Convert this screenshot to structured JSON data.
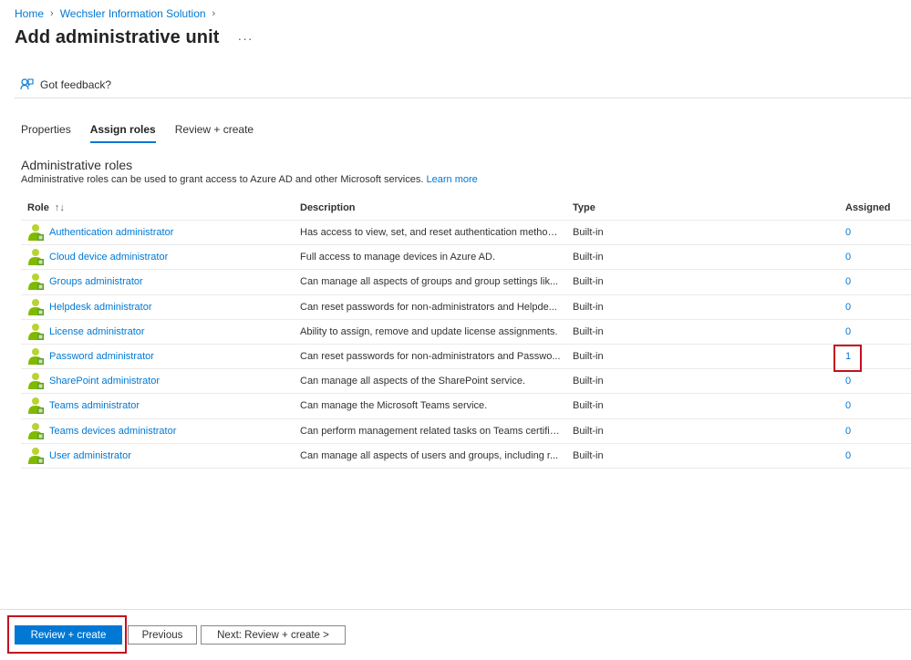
{
  "breadcrumb": {
    "home": "Home",
    "tenant": "Wechsler Information Solution"
  },
  "header": {
    "title": "Add administrative unit",
    "more": "···"
  },
  "feedback": {
    "label": "Got feedback?"
  },
  "tabs": [
    {
      "label": "Properties",
      "active": false
    },
    {
      "label": "Assign roles",
      "active": true
    },
    {
      "label": "Review + create",
      "active": false
    }
  ],
  "section": {
    "title": "Administrative roles",
    "description": "Administrative roles can be used to grant access to Azure AD and other Microsoft services.",
    "learn_more": "Learn more"
  },
  "table": {
    "headers": {
      "role": "Role",
      "description": "Description",
      "type": "Type",
      "assigned": "Assigned"
    },
    "rows": [
      {
        "role": "Authentication administrator",
        "description": "Has access to view, set, and reset authentication method ...",
        "type": "Built-in",
        "assigned": "0"
      },
      {
        "role": "Cloud device administrator",
        "description": "Full access to manage devices in Azure AD.",
        "type": "Built-in",
        "assigned": "0"
      },
      {
        "role": "Groups administrator",
        "description": "Can manage all aspects of groups and group settings lik...",
        "type": "Built-in",
        "assigned": "0"
      },
      {
        "role": "Helpdesk administrator",
        "description": "Can reset passwords for non-administrators and Helpde...",
        "type": "Built-in",
        "assigned": "0"
      },
      {
        "role": "License administrator",
        "description": "Ability to assign, remove and update license assignments.",
        "type": "Built-in",
        "assigned": "0"
      },
      {
        "role": "Password administrator",
        "description": "Can reset passwords for non-administrators and Passwo...",
        "type": "Built-in",
        "assigned": "1"
      },
      {
        "role": "SharePoint administrator",
        "description": "Can manage all aspects of the SharePoint service.",
        "type": "Built-in",
        "assigned": "0"
      },
      {
        "role": "Teams administrator",
        "description": "Can manage the Microsoft Teams service.",
        "type": "Built-in",
        "assigned": "0"
      },
      {
        "role": "Teams devices administrator",
        "description": "Can perform management related tasks on Teams certifie...",
        "type": "Built-in",
        "assigned": "0"
      },
      {
        "role": "User administrator",
        "description": "Can manage all aspects of users and groups, including r...",
        "type": "Built-in",
        "assigned": "0"
      }
    ]
  },
  "footer": {
    "review_create": "Review + create",
    "previous": "Previous",
    "next": "Next: Review + create >"
  },
  "colors": {
    "accent": "#0078d4",
    "highlight": "#c50f1f",
    "role_icon_green": "#7fba00",
    "role_icon_person": "#b8d432"
  }
}
